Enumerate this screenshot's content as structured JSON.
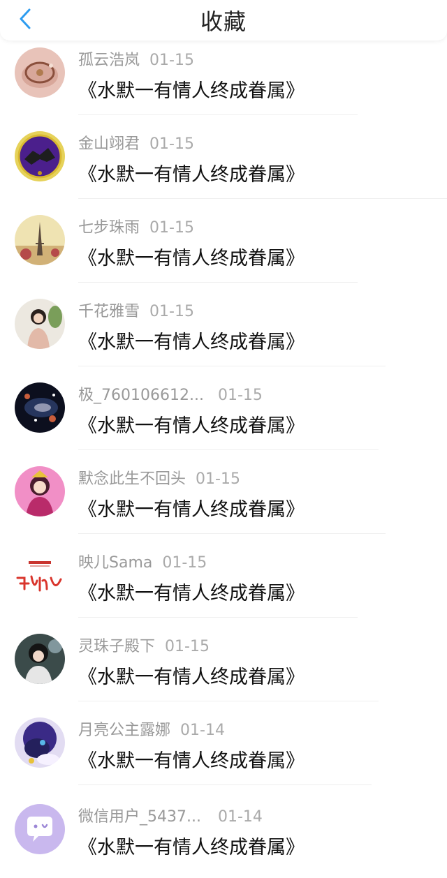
{
  "header": {
    "title": "收藏"
  },
  "items": [
    {
      "name": "孤云浩岚",
      "date": "01-15",
      "content": "《水默一有情人终成眷属》",
      "avatar_icon": "bracelet-avatar-icon"
    },
    {
      "name": "金山翊君",
      "date": "01-15",
      "content": "《水默一有情人终成眷属》",
      "avatar_icon": "dragon-emblem-avatar-icon"
    },
    {
      "name": "七步珠雨",
      "date": "01-15",
      "content": "《水默一有情人终成眷属》",
      "avatar_icon": "eiffel-tower-avatar-icon"
    },
    {
      "name": "千花雅雪",
      "date": "01-15",
      "content": "《水默一有情人终成眷属》",
      "avatar_icon": "girl-photo-avatar-icon"
    },
    {
      "name": "极_760106612...",
      "date": "01-15",
      "content": "《水默一有情人终成眷属》",
      "avatar_icon": "galaxy-avatar-icon"
    },
    {
      "name": "默念此生不回头",
      "date": "01-15",
      "content": "《水默一有情人终成眷属》",
      "avatar_icon": "pink-costume-avatar-icon"
    },
    {
      "name": "映儿Sama",
      "date": "01-15",
      "content": "《水默一有情人终成眷属》",
      "avatar_icon": "calligraphy-avatar-icon"
    },
    {
      "name": "灵珠子殿下",
      "date": "01-15",
      "content": "《水默一有情人终成眷属》",
      "avatar_icon": "anime-boy-avatar-icon"
    },
    {
      "name": "月亮公主露娜",
      "date": "01-14",
      "content": "《水默一有情人终成眷属》",
      "avatar_icon": "pony-avatar-icon"
    },
    {
      "name": "微信用户_5437...",
      "date": "01-14",
      "content": "《水默一有情人终成眷属》",
      "avatar_icon": "chat-bubble-avatar-icon"
    }
  ]
}
